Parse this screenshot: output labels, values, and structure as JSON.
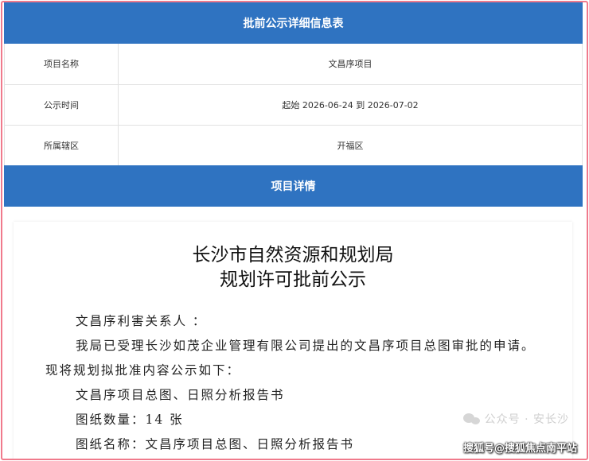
{
  "header": {
    "title": "批前公示详细信息表"
  },
  "info_rows": [
    {
      "label": "项目名称",
      "value": "文昌序项目"
    },
    {
      "label": "公示时间",
      "value": "起始 2026-06-24 到 2026-07-02"
    },
    {
      "label": "所属辖区",
      "value": "开福区"
    }
  ],
  "detail_header": {
    "title": "项目详情"
  },
  "notice": {
    "title_line1": "长沙市自然资源和规划局",
    "title_line2": "规划许可批前公示",
    "salutation": "文昌序利害关系人 ：",
    "paragraph1": "我局已受理长沙如茂企业管理有限公司提出的文昌序项目总图审批的申请。现将规划拟批准内容公示如下：",
    "line_project": "文昌序项目总图、日照分析报告书",
    "line_count": "图纸数量：14 张",
    "line_name": "图纸名称：文昌序项目总图、日照分析报告书"
  },
  "watermark": {
    "text": "公众号 · 安长沙",
    "icon": "wechat-icon"
  },
  "source_tag": {
    "text": "搜狐号@搜狐焦点南平站"
  }
}
